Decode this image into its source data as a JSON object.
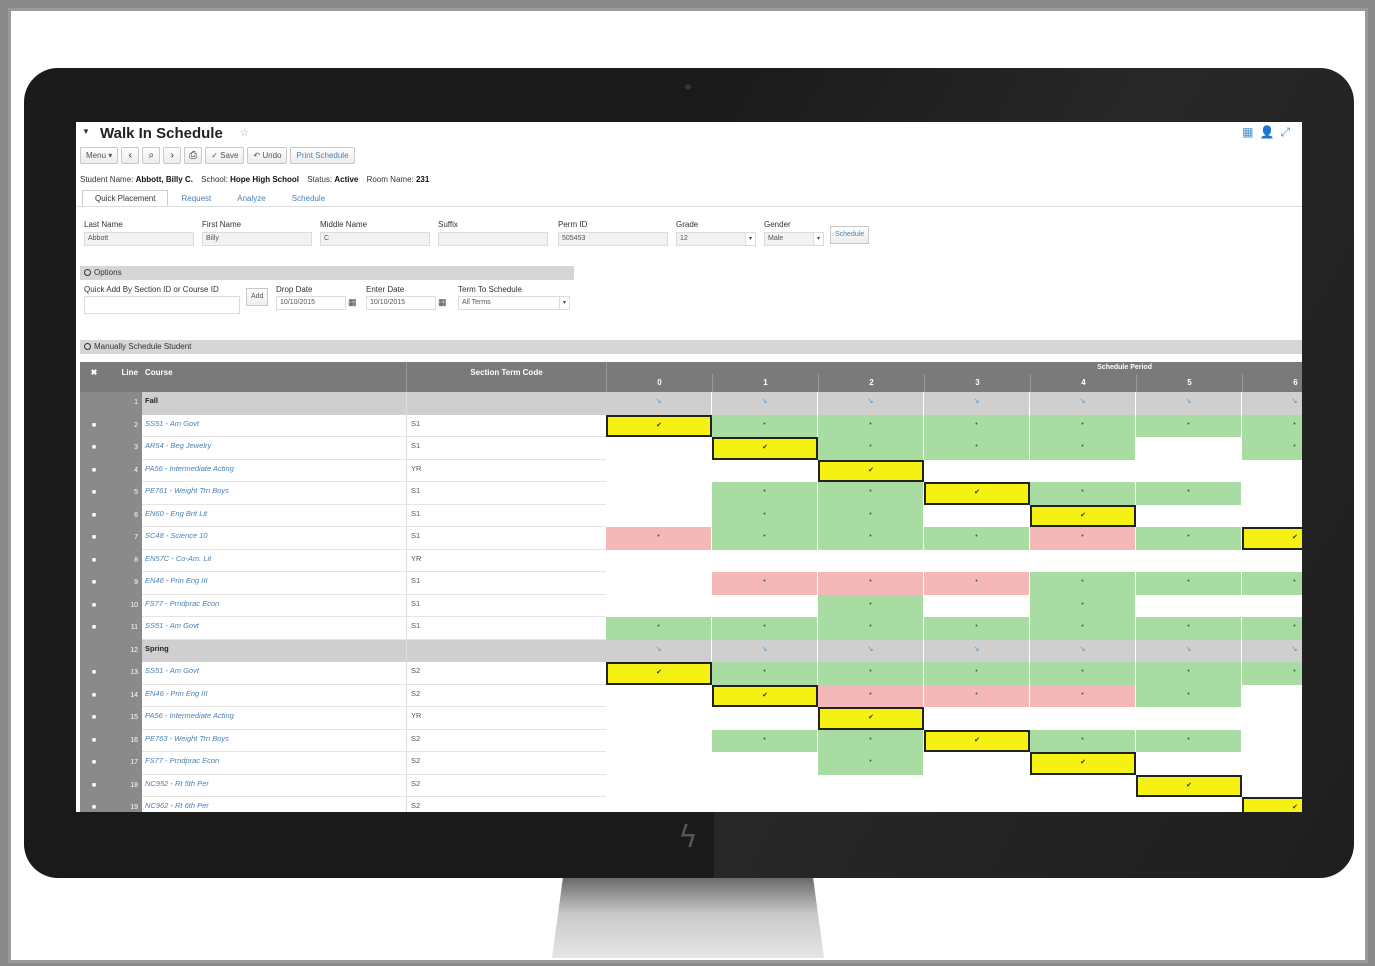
{
  "app": {
    "title": "Walk In Schedule",
    "title_star": "☆",
    "title_collapse": "▼"
  },
  "toolbar": {
    "menu_label": "Menu ▾",
    "prev_icon": "‹",
    "search_icon": "⌕",
    "next_icon": "›",
    "print_icon": "⎙",
    "save_label": "✓ Save",
    "undo_label": "↶ Undo",
    "print_schedule_label": "Print Schedule"
  },
  "student_info": {
    "name_label": "Student Name:",
    "name_value": "Abbott, Billy C.",
    "school_label": "School:",
    "school_value": "Hope High School",
    "status_label": "Status:",
    "status_value": "Active",
    "room_label": "Room Name:",
    "room_value": "231"
  },
  "tabs": [
    "Quick Placement",
    "Request",
    "Analyze",
    "Schedule"
  ],
  "fields": {
    "last_name": {
      "label": "Last Name",
      "value": "Abbott"
    },
    "first_name": {
      "label": "First Name",
      "value": "Billy"
    },
    "middle_name": {
      "label": "Middle Name",
      "value": "C"
    },
    "suffix": {
      "label": "Suffix",
      "value": ""
    },
    "perm_id": {
      "label": "Perm ID",
      "value": "505453"
    },
    "grade": {
      "label": "Grade",
      "value": "12"
    },
    "gender": {
      "label": "Gender",
      "value": "Male"
    },
    "schedule_btn": "Schedule"
  },
  "options": {
    "header": "Options",
    "quick_add_label": "Quick Add By Section ID or Course ID",
    "add_btn": "Add",
    "drop_date_label": "Drop Date",
    "drop_date_value": "10/10/2015",
    "enter_date_label": "Enter Date",
    "enter_date_value": "10/10/2015",
    "term_label": "Term To Schedule",
    "term_value": "All Terms"
  },
  "manual": {
    "header": "Manually Schedule Student"
  },
  "grid": {
    "col_x": "✖",
    "col_line": "Line",
    "col_course": "Course",
    "col_term": "Section Term Code",
    "schedule_period_label": "Schedule Period",
    "periods": [
      "0",
      "1",
      "2",
      "3",
      "4",
      "5",
      "6"
    ],
    "rows": [
      {
        "line": "1",
        "term_header": true,
        "course": "Fall",
        "cells": [
          "t",
          "t",
          "t",
          "t",
          "t",
          "t",
          "t"
        ]
      },
      {
        "line": "2",
        "course": "SS51 - Am Govt",
        "term": "S1",
        "cells": [
          "y",
          "g",
          "g",
          "g",
          "g",
          "g",
          "g"
        ]
      },
      {
        "line": "3",
        "course": "AR54 - Beg Jewelry",
        "term": "S1",
        "cells": [
          "w",
          "y",
          "g",
          "g",
          "g",
          "w",
          "g"
        ]
      },
      {
        "line": "4",
        "course": "PA56 - Intermediate Acting",
        "term": "YR",
        "cells": [
          "w",
          "w",
          "y",
          "w",
          "w",
          "w",
          "w"
        ]
      },
      {
        "line": "5",
        "course": "PE761 - Weight Trn Boys",
        "term": "S1",
        "cells": [
          "w",
          "g",
          "g",
          "y",
          "g",
          "g",
          "w"
        ]
      },
      {
        "line": "6",
        "course": "EN60 - Eng Brit Lit",
        "term": "S1",
        "cells": [
          "w",
          "g",
          "g",
          "w",
          "y",
          "w",
          "w"
        ]
      },
      {
        "line": "7",
        "course": "SC48 - Science 10",
        "term": "S1",
        "cells": [
          "r",
          "g",
          "g",
          "g",
          "r",
          "g",
          "y"
        ]
      },
      {
        "line": "8",
        "course": "EN57C - Co-Am. Lit",
        "term": "YR",
        "cells": [
          "w",
          "w",
          "w",
          "w",
          "w",
          "w",
          "w"
        ]
      },
      {
        "line": "9",
        "course": "EN46 - Prin Eng III",
        "term": "S1",
        "cells": [
          "w",
          "r",
          "r",
          "r",
          "g",
          "g",
          "g"
        ]
      },
      {
        "line": "10",
        "course": "FS77 - Prndprac Econ",
        "term": "S1",
        "cells": [
          "w",
          "w",
          "g",
          "w",
          "g",
          "w",
          "w"
        ]
      },
      {
        "line": "11",
        "course": "SS51 - Am Govt",
        "term": "S1",
        "cells": [
          "g",
          "g",
          "g",
          "g",
          "g",
          "g",
          "g"
        ]
      },
      {
        "line": "12",
        "term_header": true,
        "course": "Spring",
        "cells": [
          "t",
          "t",
          "t",
          "t",
          "t",
          "t",
          "t"
        ]
      },
      {
        "line": "13",
        "course": "SS51 - Am Govt",
        "term": "S2",
        "cells": [
          "y",
          "g",
          "g",
          "g",
          "g",
          "g",
          "g"
        ]
      },
      {
        "line": "14",
        "course": "EN46 - Prin Eng III",
        "term": "S2",
        "cells": [
          "w",
          "y",
          "r",
          "r",
          "r",
          "g",
          "w"
        ]
      },
      {
        "line": "15",
        "course": "PA56 - Intermediate Acting",
        "term": "YR",
        "cells": [
          "w",
          "w",
          "y",
          "w",
          "w",
          "w",
          "w"
        ]
      },
      {
        "line": "16",
        "course": "PE763 - Weight Trn Boys",
        "term": "S2",
        "cells": [
          "w",
          "g",
          "g",
          "y",
          "g",
          "g",
          "w"
        ]
      },
      {
        "line": "17",
        "course": "FS77 - Prndprac Econ",
        "term": "S2",
        "cells": [
          "w",
          "w",
          "g",
          "w",
          "y",
          "w",
          "w"
        ]
      },
      {
        "line": "18",
        "course": "NC952 - Rt 5th Per",
        "term": "S2",
        "cells": [
          "w",
          "w",
          "w",
          "w",
          "w",
          "y",
          "w"
        ]
      },
      {
        "line": "19",
        "course": "NC962 - Rt 6th Per",
        "term": "S2",
        "cells": [
          "w",
          "w",
          "w",
          "w",
          "w",
          "w",
          "y"
        ]
      }
    ]
  },
  "colors": {
    "green": "#a9dca3",
    "red": "#f5b8b8",
    "yellow": "#f4f113",
    "header_gray": "#7a7a7a",
    "link_blue": "#4a7fb5"
  },
  "icons": {
    "top_right": [
      "grid-icon",
      "person-icon",
      "expand-icon"
    ],
    "monitor_logo": "lightning-logo-icon"
  }
}
